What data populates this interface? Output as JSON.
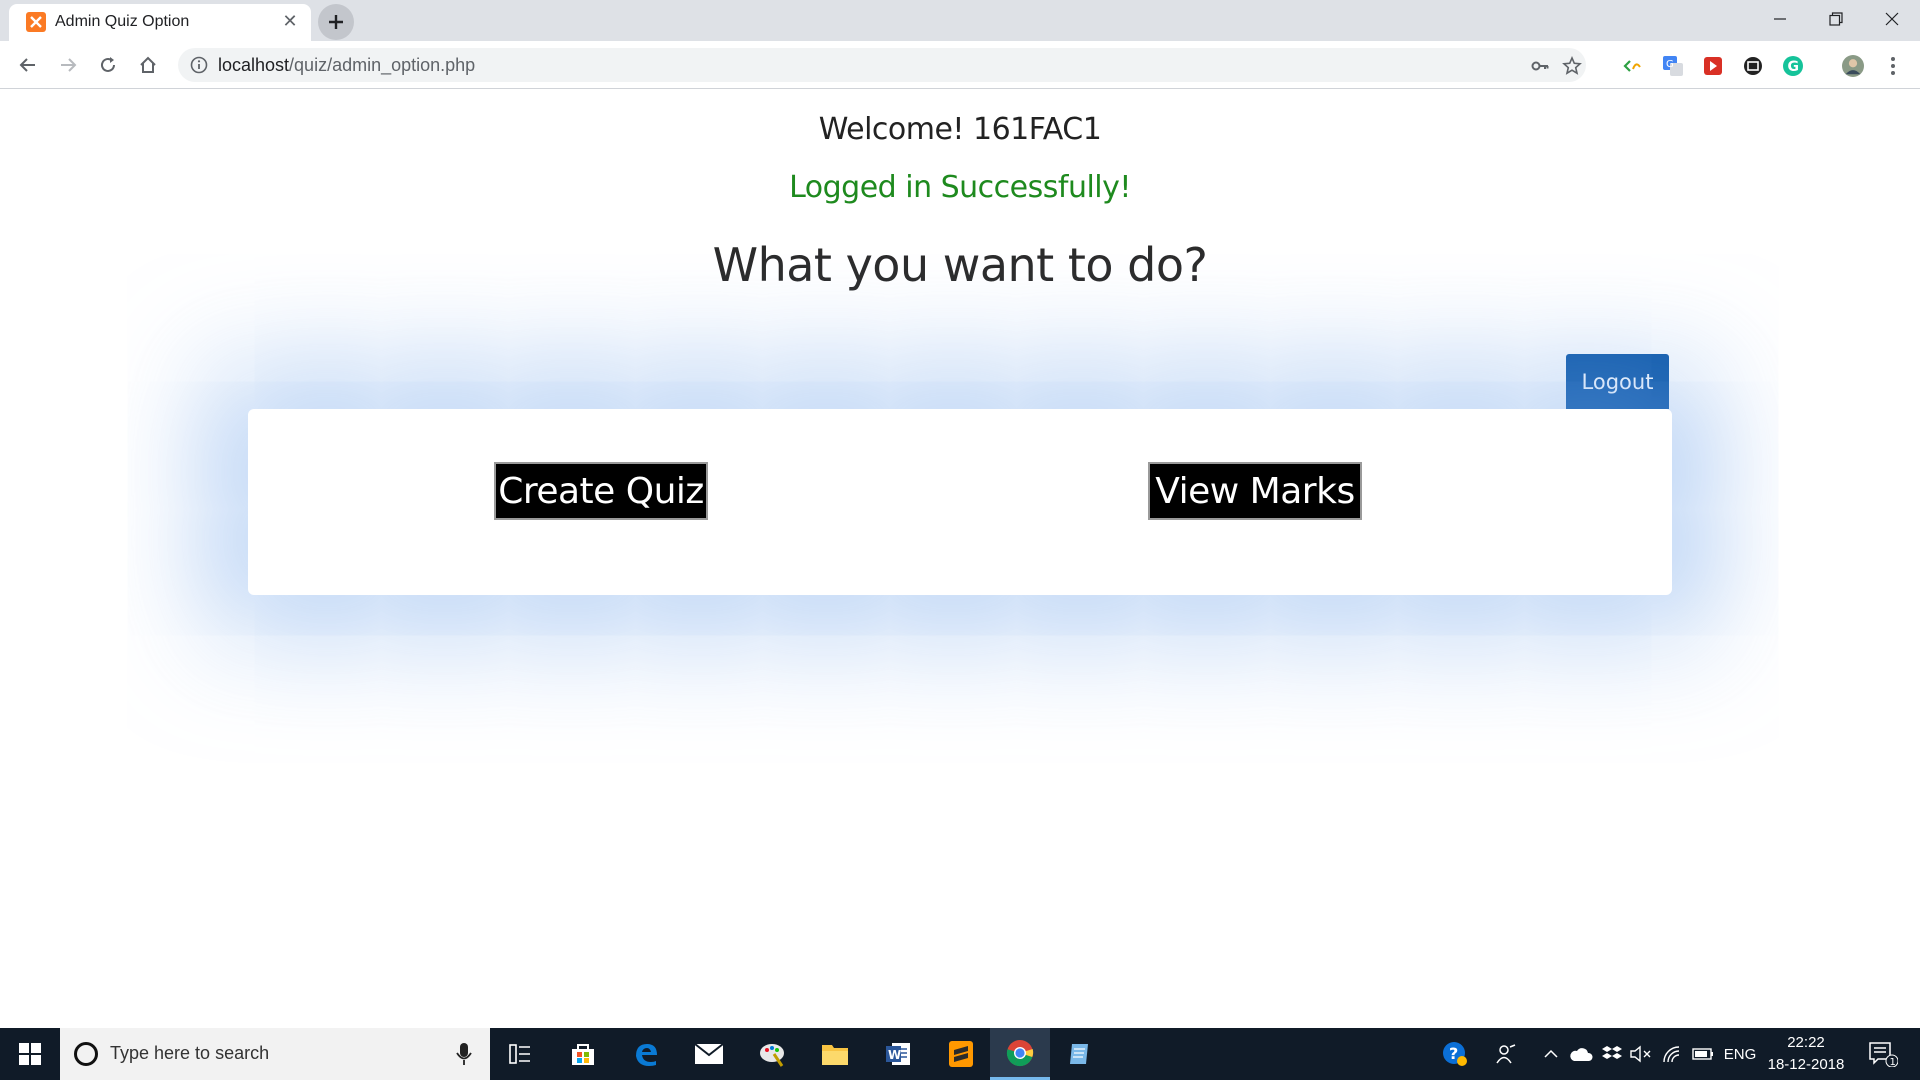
{
  "browser": {
    "tab_title": "Admin Quiz Option",
    "tab_close": "✕",
    "url_host": "localhost",
    "url_path": "/quiz/admin_option.php"
  },
  "page": {
    "welcome": "Welcome! 161FAC1",
    "status": "Logged in Successfully!",
    "question": "What you want to do?",
    "logout_label": "Logout",
    "create_label": "Create Quiz",
    "marks_label": "View Marks",
    "colors": {
      "status_green": "#1e8a1e",
      "logout_blue": "#0d58a8",
      "card_glow": "#78aaeb"
    }
  },
  "taskbar": {
    "search_placeholder": "Type here to search",
    "language": "ENG",
    "time": "22:22",
    "date": "18-12-2018",
    "notification_count": "1"
  }
}
